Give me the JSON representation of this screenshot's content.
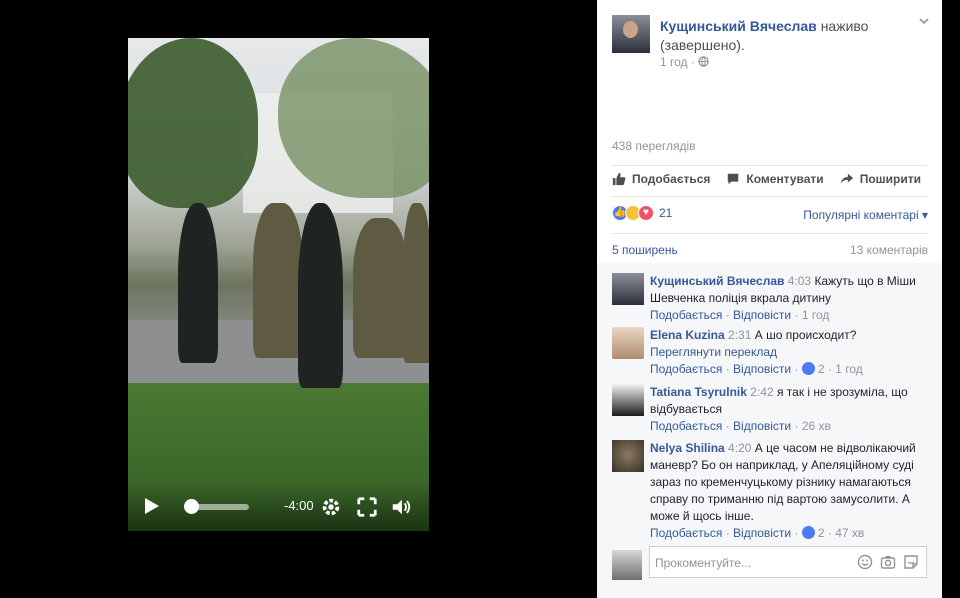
{
  "video": {
    "time_remaining": "-4:00",
    "progress_fraction": 0.08,
    "icons": [
      "play-icon",
      "settings-gear-icon",
      "fullscreen-icon",
      "volume-icon"
    ]
  },
  "post": {
    "author": "Кущинський Вячеслав",
    "status": "наживо (завершено).",
    "time": "1 год",
    "separator": "·",
    "privacy_icon": "globe-icon",
    "views": "438 переглядів"
  },
  "actions": {
    "like": "Подобається",
    "comment": "Коментувати",
    "share": "Поширити"
  },
  "reactions": {
    "count": "21",
    "types": [
      "like",
      "haha",
      "love"
    ],
    "sort_label": "Популярні коментарі"
  },
  "stats": {
    "shares": "5 поширень",
    "comments": "13 коментарів"
  },
  "comments": [
    {
      "name": "Кущинський Вячеслав",
      "time": "4:03",
      "text": "Кажуть що в Міши Шевченка поліція вкрала дитину",
      "like": "Подобається",
      "reply": "Відповісти",
      "likes": "",
      "ago": "1 год"
    },
    {
      "name": "Elena Kuzina",
      "time": "2:31",
      "text": "А шо происходит?",
      "translate": "Переглянути переклад",
      "like": "Подобається",
      "reply": "Відповісти",
      "likes": "2",
      "ago": "1 год"
    },
    {
      "name": "Tatiana Tsyrulnik",
      "time": "2:42",
      "text": "я так і не зрозуміла, що відбувається",
      "like": "Подобається",
      "reply": "Відповісти",
      "likes": "",
      "ago": "26 хв"
    },
    {
      "name": "Nelya Shilina",
      "time": "4:20",
      "text": "А це часом не відволікаючий маневр? Бо он наприклад, у Апеляційному суді зараз по кременчуцькому різнику намагаються справу по триманню під вартою замусолити. А може й щось інше.",
      "like": "Подобається",
      "reply": "Відповісти",
      "likes": "2",
      "ago": "47 хв"
    }
  ],
  "composer": {
    "placeholder": "Прокоментуйте..."
  },
  "colors": {
    "link": "#365899",
    "muted": "#90949c",
    "like_blue": "#4a7bf0"
  }
}
